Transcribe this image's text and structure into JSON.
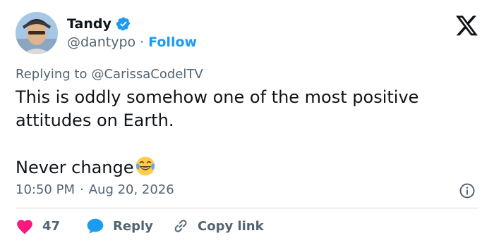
{
  "author": {
    "name": "Tandy",
    "handle": "@dantypo",
    "separator": "·",
    "follow_label": "Follow"
  },
  "tweet": {
    "replying_prefix": "Replying to",
    "replying_to": "@CarissaCodelTV",
    "text_line1": "This is oddly somehow one of the most positive",
    "text_line2": "attitudes on Earth.",
    "text_line3": "Never change",
    "emoji": "face-with-tears-of-joy",
    "time": "10:50 PM",
    "date_separator": "·",
    "date": "Aug 20, 2026"
  },
  "actions": {
    "like_count": "47",
    "reply_label": "Reply",
    "copy_link_label": "Copy link"
  },
  "colors": {
    "accent": "#1d9bf0",
    "like": "#f91880",
    "text": "#0f1419",
    "muted": "#536471"
  }
}
